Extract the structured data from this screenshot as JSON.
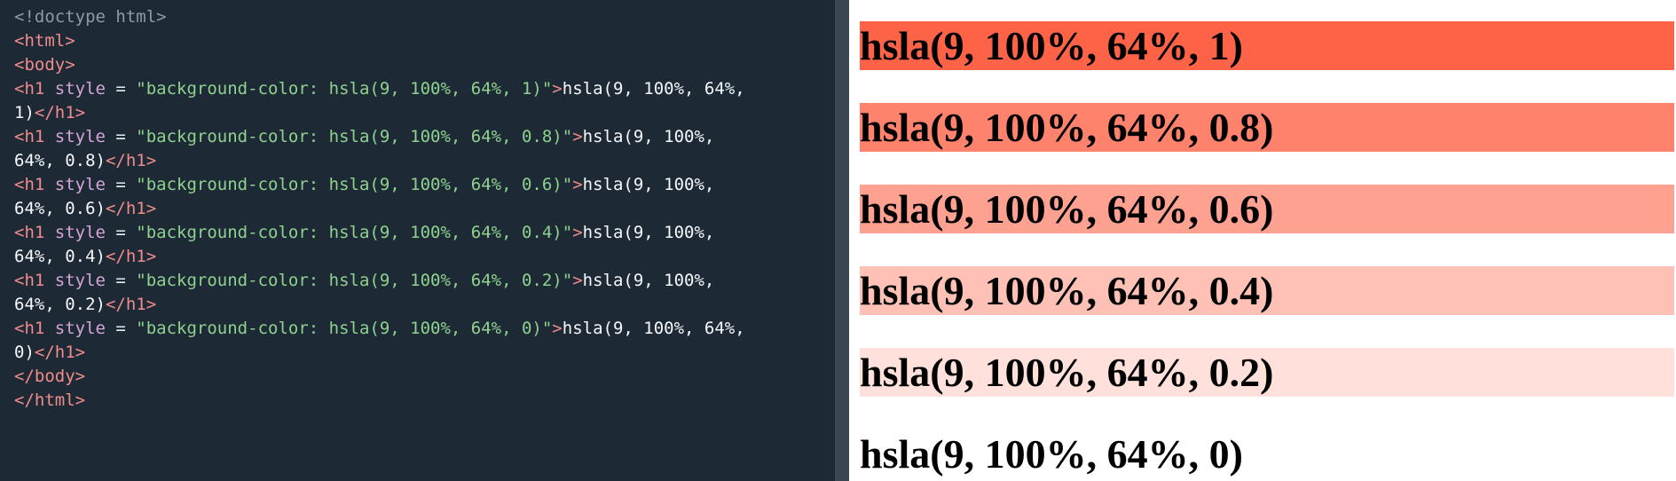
{
  "editor": {
    "lines": [
      [
        [
          "doctype",
          "<!doctype html>"
        ]
      ],
      [
        [
          "tag",
          "<html>"
        ]
      ],
      [
        [
          "tag",
          "<body>"
        ]
      ],
      [
        [
          "tag",
          "<h1"
        ],
        [
          "attr",
          " style"
        ],
        [
          "punct",
          " = "
        ],
        [
          "str",
          "\"background-color: hsla(9, 100%, 64%, 1)\""
        ],
        [
          "tag",
          ">"
        ],
        [
          "text",
          "hsla(9, 100%, 64%,"
        ]
      ],
      [
        [
          "text",
          "1)"
        ],
        [
          "tag",
          "</h1>"
        ]
      ],
      [
        [
          "tag",
          "<h1"
        ],
        [
          "attr",
          " style"
        ],
        [
          "punct",
          " = "
        ],
        [
          "str",
          "\"background-color: hsla(9, 100%, 64%, 0.8)\""
        ],
        [
          "tag",
          ">"
        ],
        [
          "text",
          "hsla(9, 100%,"
        ]
      ],
      [
        [
          "text",
          "64%, 0.8)"
        ],
        [
          "tag",
          "</h1>"
        ]
      ],
      [
        [
          "tag",
          "<h1"
        ],
        [
          "attr",
          " style"
        ],
        [
          "punct",
          " = "
        ],
        [
          "str",
          "\"background-color: hsla(9, 100%, 64%, 0.6)\""
        ],
        [
          "tag",
          ">"
        ],
        [
          "text",
          "hsla(9, 100%,"
        ]
      ],
      [
        [
          "text",
          "64%, 0.6)"
        ],
        [
          "tag",
          "</h1>"
        ]
      ],
      [
        [
          "tag",
          "<h1"
        ],
        [
          "attr",
          " style"
        ],
        [
          "punct",
          " = "
        ],
        [
          "str",
          "\"background-color: hsla(9, 100%, 64%, 0.4)\""
        ],
        [
          "tag",
          ">"
        ],
        [
          "text",
          "hsla(9, 100%,"
        ]
      ],
      [
        [
          "text",
          "64%, 0.4)"
        ],
        [
          "tag",
          "</h1>"
        ]
      ],
      [
        [
          "tag",
          "<h1"
        ],
        [
          "attr",
          " style"
        ],
        [
          "punct",
          " = "
        ],
        [
          "str",
          "\"background-color: hsla(9, 100%, 64%, 0.2)\""
        ],
        [
          "tag",
          ">"
        ],
        [
          "text",
          "hsla(9, 100%,"
        ]
      ],
      [
        [
          "text",
          "64%, 0.2)"
        ],
        [
          "tag",
          "</h1>"
        ]
      ],
      [
        [
          "tag",
          "<h1"
        ],
        [
          "attr",
          " style"
        ],
        [
          "punct",
          " = "
        ],
        [
          "str",
          "\"background-color: hsla(9, 100%, 64%, 0)\""
        ],
        [
          "tag",
          ">"
        ],
        [
          "text",
          "hsla(9, 100%, 64%,"
        ]
      ],
      [
        [
          "text",
          "0)"
        ],
        [
          "tag",
          "</h1>"
        ]
      ],
      [
        [
          "tag",
          "</body>"
        ]
      ],
      [
        [
          "tag",
          "</html>"
        ]
      ]
    ]
  },
  "preview": {
    "headings": [
      {
        "text": "hsla(9, 100%, 64%, 1)",
        "color": "hsla(9, 100%, 64%, 1)"
      },
      {
        "text": "hsla(9, 100%, 64%, 0.8)",
        "color": "hsla(9, 100%, 64%, 0.8)"
      },
      {
        "text": "hsla(9, 100%, 64%, 0.6)",
        "color": "hsla(9, 100%, 64%, 0.6)"
      },
      {
        "text": "hsla(9, 100%, 64%, 0.4)",
        "color": "hsla(9, 100%, 64%, 0.4)"
      },
      {
        "text": "hsla(9, 100%, 64%, 0.2)",
        "color": "hsla(9, 100%, 64%, 0.2)"
      },
      {
        "text": "hsla(9, 100%, 64%, 0)",
        "color": "hsla(9, 100%, 64%, 0)"
      }
    ]
  }
}
